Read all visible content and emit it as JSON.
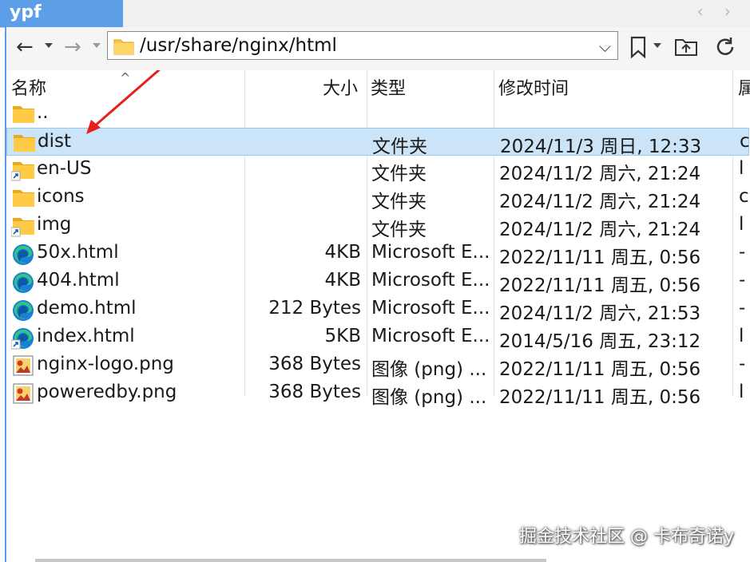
{
  "tab": {
    "title": "ypf",
    "arrows": "‹ ›"
  },
  "toolbar": {
    "back": "←",
    "forward": "→",
    "address": "/usr/share/nginx/html"
  },
  "columns": {
    "name": "名称",
    "size": "大小",
    "type": "类型",
    "modified": "修改时间",
    "extra": "属"
  },
  "rows": [
    {
      "name": "..",
      "size": "",
      "type": "",
      "modified": "",
      "extra": "",
      "icon": "folder-up-icon"
    },
    {
      "name": "dist",
      "size": "",
      "type": "文件夹",
      "modified": "2024/11/3 周日, 12:33",
      "extra": "c",
      "icon": "folder-icon"
    },
    {
      "name": "en-US",
      "size": "",
      "type": "文件夹",
      "modified": "2024/11/2 周六, 21:24",
      "extra": "l",
      "icon": "folder-link-icon"
    },
    {
      "name": "icons",
      "size": "",
      "type": "文件夹",
      "modified": "2024/11/2 周六, 21:24",
      "extra": "c",
      "icon": "folder-icon"
    },
    {
      "name": "img",
      "size": "",
      "type": "文件夹",
      "modified": "2024/11/2 周六, 21:24",
      "extra": "l",
      "icon": "folder-link-icon"
    },
    {
      "name": "50x.html",
      "size": "4KB",
      "type": "Microsoft E...",
      "modified": "2022/11/11 周五, 0:56",
      "extra": "-",
      "icon": "edge-html-icon"
    },
    {
      "name": "404.html",
      "size": "4KB",
      "type": "Microsoft E...",
      "modified": "2022/11/11 周五, 0:56",
      "extra": "-",
      "icon": "edge-html-icon"
    },
    {
      "name": "demo.html",
      "size": "212 Bytes",
      "type": "Microsoft E...",
      "modified": "2024/11/2 周六, 21:53",
      "extra": "-",
      "icon": "edge-html-icon"
    },
    {
      "name": "index.html",
      "size": "5KB",
      "type": "Microsoft E...",
      "modified": "2014/5/16 周五, 23:12",
      "extra": "l",
      "icon": "edge-html-link-icon"
    },
    {
      "name": "nginx-logo.png",
      "size": "368 Bytes",
      "type": "图像 (png) ...",
      "modified": "2022/11/11 周五, 0:56",
      "extra": "-",
      "icon": "image-file-icon"
    },
    {
      "name": "poweredby.png",
      "size": "368 Bytes",
      "type": "图像 (png) ...",
      "modified": "2022/11/11 周五, 0:56",
      "extra": "l",
      "icon": "image-file-icon"
    }
  ],
  "selected_row": "dist",
  "watermark": "掘金技术社区 @ 卡布奇诺y",
  "colors": {
    "tab_blue": "#5c9ee8",
    "selection": "#cce4f7",
    "selection_border": "#99c9ef",
    "folder_yellow": "#ffc83d",
    "annotation_red": "#e8201c",
    "edge_blue": "#1a7fd6",
    "edge_green": "#33c481"
  }
}
